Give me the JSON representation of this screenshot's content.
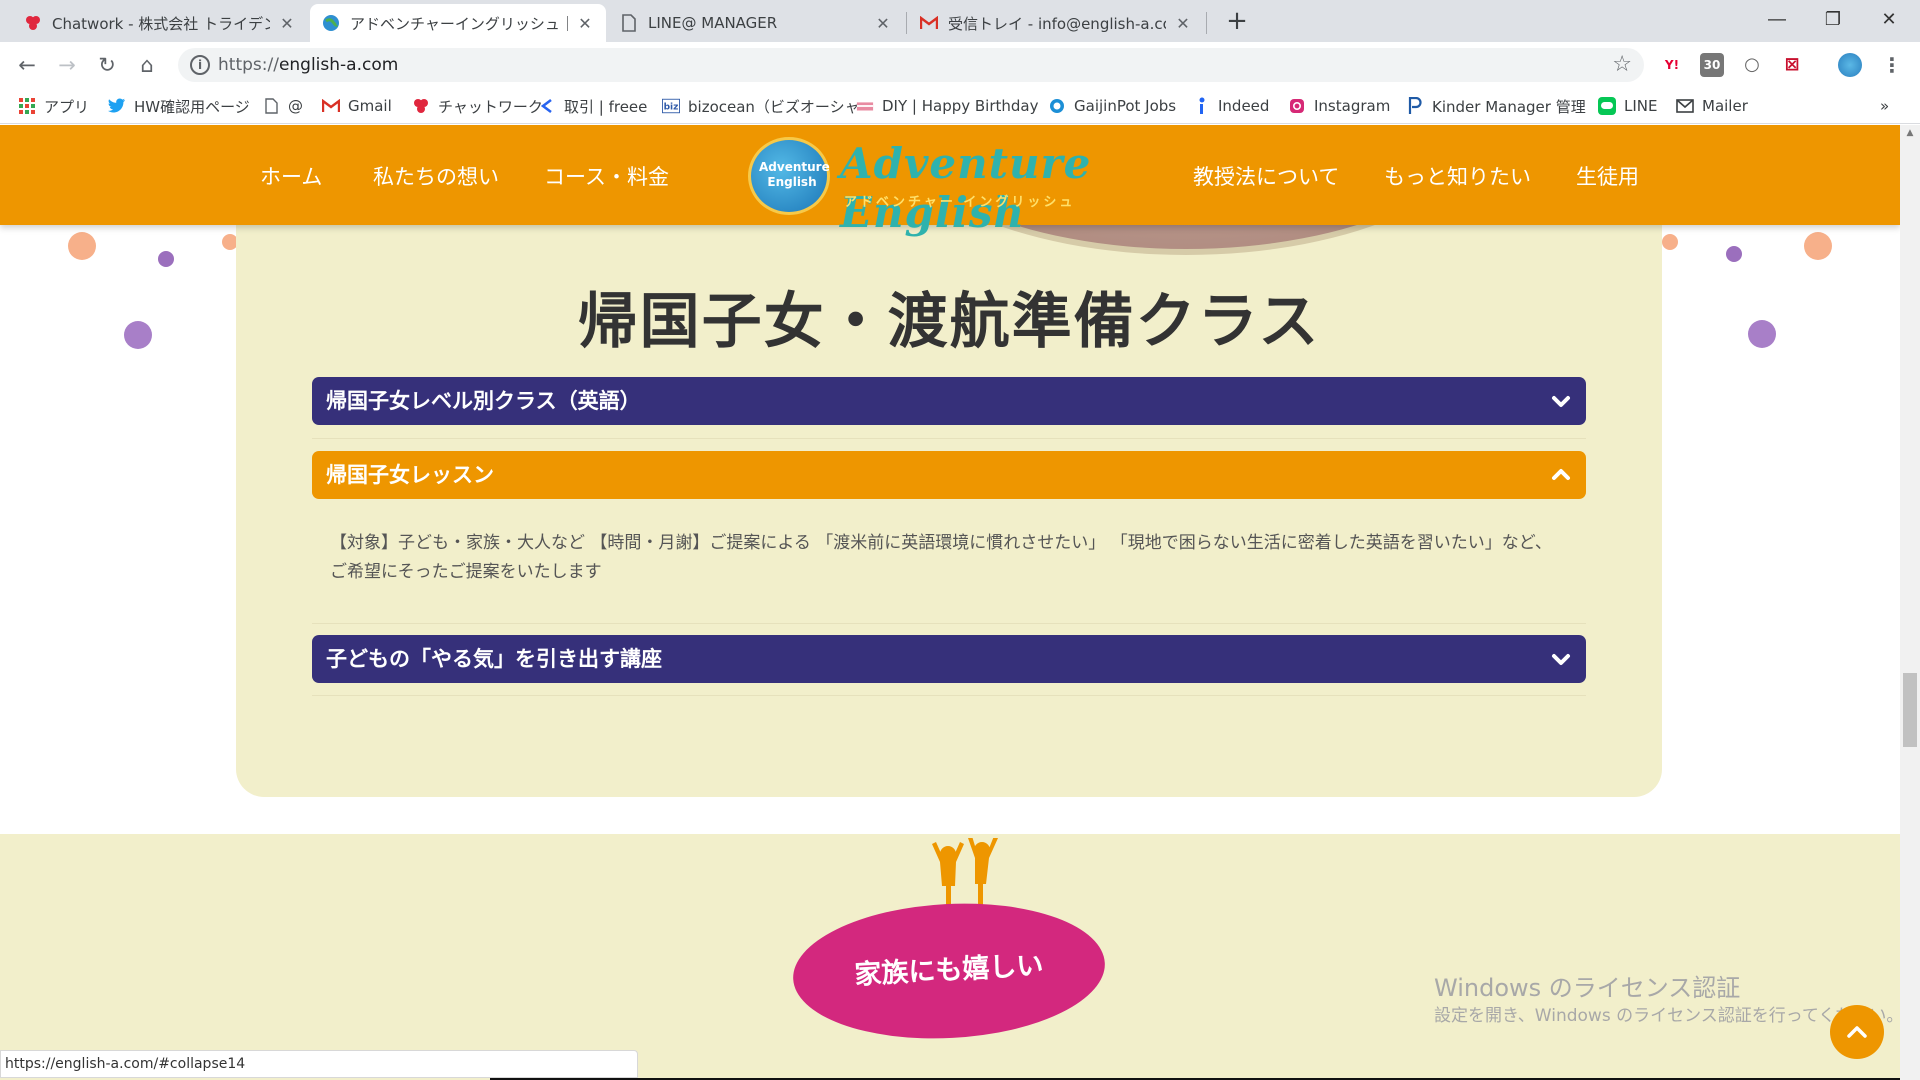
{
  "browser": {
    "tabs": [
      {
        "title": "Chatwork - 株式会社 トライデントワ",
        "icon": "chatwork-icon",
        "active": false
      },
      {
        "title": "アドベンチャーイングリッシュ｜宇都宮(",
        "icon": "globe-icon",
        "active": true
      },
      {
        "title": "LINE@ MANAGER",
        "icon": "page-icon",
        "active": false
      },
      {
        "title": "受信トレイ - info@english-a.com -",
        "icon": "gmail-icon",
        "active": false
      }
    ],
    "new_tab": "+",
    "url_scheme": "https://",
    "url_host": "english-a.com",
    "extensions": [
      "Y!",
      "30",
      "○",
      "⊠"
    ],
    "bookmarks": [
      {
        "label": "アプリ",
        "icon": "apps-grid-icon"
      },
      {
        "label": "HW確認用ページ",
        "icon": "twitter-icon"
      },
      {
        "label": "@",
        "icon": "page-icon"
      },
      {
        "label": "Gmail",
        "icon": "gmail-icon"
      },
      {
        "label": "チャットワーク",
        "icon": "chatwork-icon"
      },
      {
        "label": "取引 | freee",
        "icon": "freee-icon"
      },
      {
        "label": "bizocean（ビズオーシャ",
        "icon": "biz-icon"
      },
      {
        "label": "DIY | Happy Birthday",
        "icon": "diy-icon"
      },
      {
        "label": "GaijinPot Jobs",
        "icon": "gaijinpot-icon"
      },
      {
        "label": "Indeed",
        "icon": "indeed-icon"
      },
      {
        "label": "Instagram",
        "icon": "instagram-icon"
      },
      {
        "label": "Kinder Manager 管理",
        "icon": "kinder-icon"
      },
      {
        "label": "LINE",
        "icon": "line-icon"
      },
      {
        "label": "Mailer",
        "icon": "mail-icon"
      }
    ],
    "bookmarks_overflow": "»",
    "status_url": "https://english-a.com/#collapse14"
  },
  "site": {
    "nav_left": [
      "ホーム",
      "私たちの想い",
      "コース・料金"
    ],
    "nav_right": [
      "教授法について",
      "もっと知りたい",
      "生徒用"
    ],
    "logo_text": "Adventure English",
    "logo_badge": "Adventure English",
    "logo_kana": "アドベンチャー イングリッシュ",
    "section_title": "帰国子女・渡航準備クラス",
    "accordion": [
      {
        "label": "帰国子女レベル別クラス（英語）",
        "open": false
      },
      {
        "label": "帰国子女レッスン",
        "open": true,
        "body": "【対象】子ども・家族・大人など 【時間・月謝】ご提案による 「渡米前に英語環境に慣れさせたい」 「現地で困らない生活に密着した英語を習いたい」など、ご希望にそったご提案をいたします"
      },
      {
        "label": "子どもの「やる気」を引き出す講座",
        "open": false
      }
    ],
    "family_badge": "家族にも嬉しい"
  },
  "os": {
    "watermark_title": "Windows のライセンス認証",
    "watermark_sub": "設定を開き、Windows のライセンス認証を行ってください。"
  },
  "colors": {
    "brand_orange": "#ee9600",
    "accordion_navy": "#36307a",
    "section_cream": "#f2efcb",
    "badge_pink": "#d3287e"
  }
}
